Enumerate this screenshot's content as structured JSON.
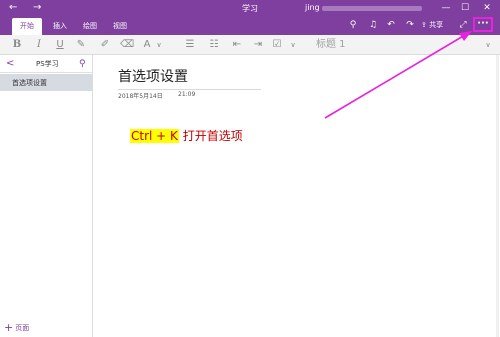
{
  "window": {
    "title": "学习",
    "user": "jing",
    "back_glyph": "←",
    "forward_glyph": "→",
    "minimize_glyph": "—",
    "maximize_glyph": "☐",
    "close_glyph": "✕"
  },
  "ribbon": {
    "tabs": [
      {
        "label": "开始",
        "active": true
      },
      {
        "label": "插入",
        "active": false
      },
      {
        "label": "绘图",
        "active": false
      },
      {
        "label": "视图",
        "active": false
      }
    ],
    "share_label": "共享",
    "more_label": "···",
    "icons": {
      "bulb": "⚲",
      "bell": "♫",
      "undo": "↶",
      "redo": "↷",
      "share": "⇪",
      "expand": "⤢"
    }
  },
  "toolbar": {
    "bold": "B",
    "italic": "I",
    "underline": "U",
    "highlight": "✎",
    "clear": "✐",
    "paint": "⌫",
    "font_format": "A",
    "dropdown": "∨",
    "bullets": "☰",
    "numbers": "☷",
    "outdent": "⇤",
    "indent": "⇥",
    "checkbox": "☑",
    "style": "标题 1"
  },
  "sidebar": {
    "back_glyph": "<",
    "section_title": "PS学习",
    "search_glyph": "⚲",
    "pages": [
      {
        "label": "首选项设置",
        "selected": true
      }
    ],
    "add_page_plus": "+",
    "add_page_label": "页面"
  },
  "page": {
    "title": "首选项设置",
    "date": "2018年5月14日",
    "time": "21:09",
    "note_highlight": "Ctrl + K",
    "note_rest": " 打开首选项"
  },
  "colors": {
    "accent": "#7f3f9f",
    "annotation": "#e823e0",
    "note_text": "#c00000",
    "highlight": "#ffff00"
  }
}
